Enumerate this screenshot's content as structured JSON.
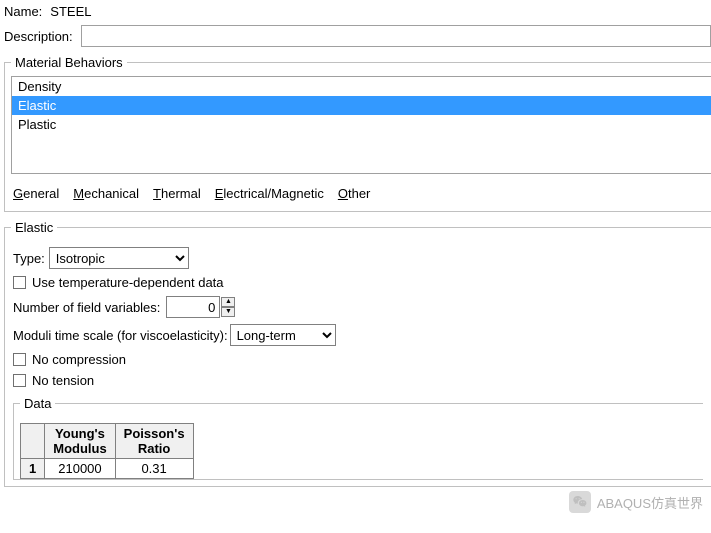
{
  "header": {
    "name_label": "Name:",
    "name_value": "STEEL",
    "desc_label": "Description:",
    "desc_value": ""
  },
  "behaviors": {
    "legend": "Material Behaviors",
    "items": [
      "Density",
      "Elastic",
      "Plastic"
    ],
    "selected_index": 1
  },
  "menus": {
    "general": "General",
    "mechanical": "Mechanical",
    "thermal": "Thermal",
    "electrical": "Electrical/Magnetic",
    "other": "Other"
  },
  "elastic": {
    "legend": "Elastic",
    "type_label": "Type:",
    "type_value": "Isotropic",
    "temp_dep_label": "Use temperature-dependent data",
    "nfv_label": "Number of field variables:",
    "nfv_value": "0",
    "moduli_label": "Moduli time scale (for viscoelasticity):",
    "moduli_value": "Long-term",
    "no_compression_label": "No compression",
    "no_tension_label": "No tension"
  },
  "data": {
    "legend": "Data",
    "col1": "Young's\nModulus",
    "col2": "Poisson's\nRatio",
    "rows": [
      {
        "n": "1",
        "ym": "210000",
        "pr": "0.31"
      }
    ]
  },
  "watermark": "ABAQUS仿真世界"
}
